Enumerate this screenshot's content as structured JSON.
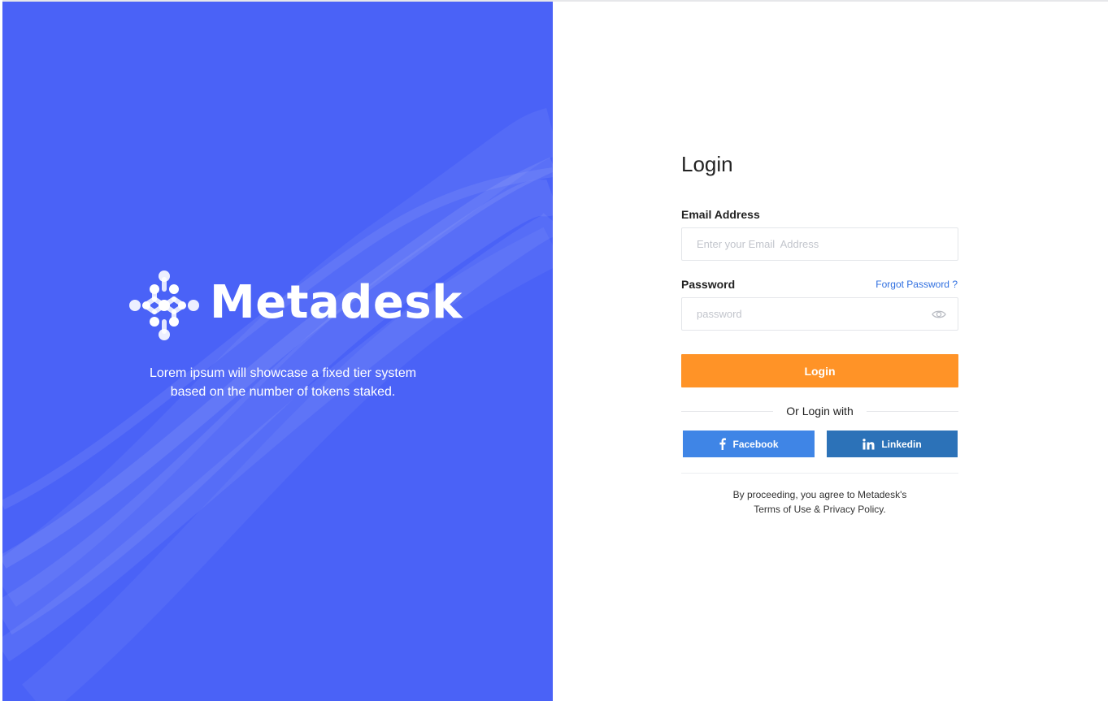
{
  "colors": {
    "brand_blue": "#4a62f7",
    "accent_orange": "#ff9327",
    "facebook_blue": "#3f85e6",
    "linkedin_blue": "#2c72b8",
    "link_blue": "#2f6fe0"
  },
  "brand": {
    "name": "Metadesk",
    "tagline_line1": "Lorem ipsum will showcase a fixed tier system",
    "tagline_line2": "based on the number of tokens staked."
  },
  "form": {
    "title": "Login",
    "email_label": "Email  Address",
    "email_placeholder": "Enter your Email  Address",
    "password_label": "Password",
    "forgot_link": "Forgot Password ?",
    "password_placeholder": "password",
    "password_toggle_icon": "eye-icon",
    "login_button": "Login",
    "or_text": "Or Login with",
    "facebook_button": "Facebook",
    "facebook_icon": "facebook-icon",
    "linkedin_button": "Linkedin",
    "linkedin_icon": "linkedin-icon",
    "terms_line1": "By proceeding, you agree to Metadesk's",
    "terms_line2": "Terms of Use & Privacy Policy."
  }
}
